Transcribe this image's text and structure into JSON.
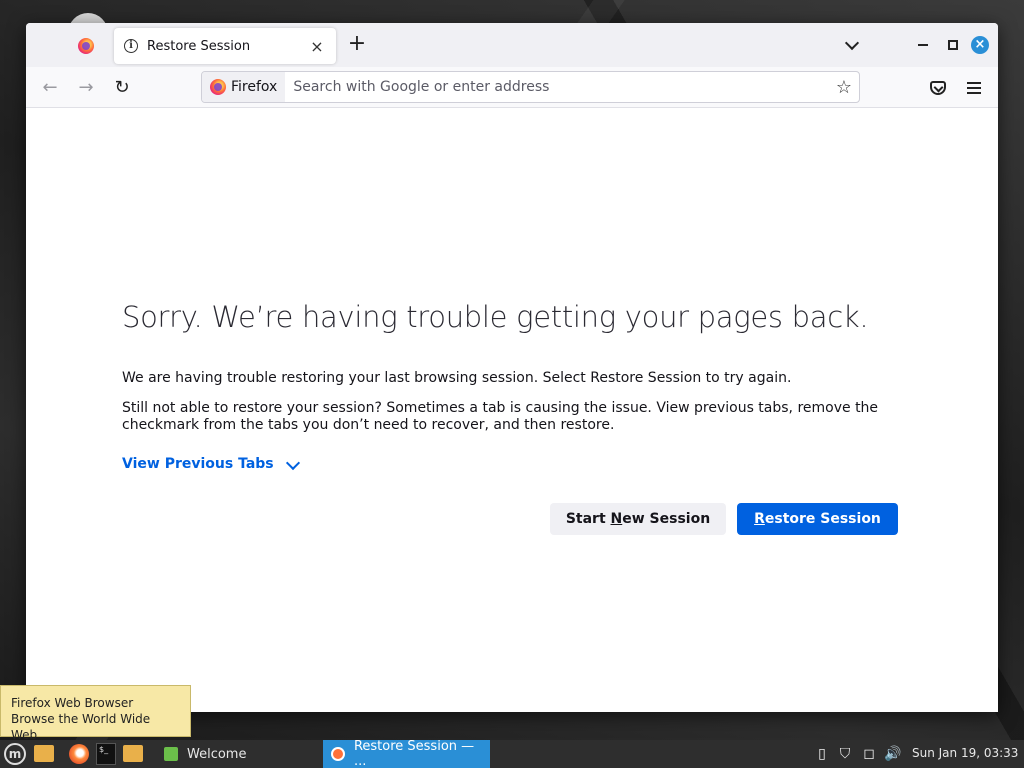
{
  "window": {
    "tab_title": "Restore Session",
    "tab_close": "×",
    "new_tab": "+"
  },
  "navbar": {
    "back": "←",
    "forward": "→",
    "reload": "↻",
    "identity_label": "Firefox",
    "url_placeholder": "Search with Google or enter address",
    "star": "☆"
  },
  "page": {
    "headline": "Sorry. We’re having trouble getting your pages back.",
    "paragraph1": "We are having trouble restoring your last browsing session. Select Restore Session to try again.",
    "paragraph2": "Still not able to restore your session? Sometimes a tab is causing the issue. View previous tabs, remove the checkmark from the tabs you don’t need to recover, and then restore.",
    "view_previous_tabs": "View Previous Tabs",
    "start_new_session": {
      "pre": "Start ",
      "accel": "N",
      "post": "ew Session"
    },
    "restore_session": {
      "accel": "R",
      "post": "estore Session"
    }
  },
  "tooltip": {
    "line1": "Firefox Web Browser",
    "line2": "Browse the World Wide Web"
  },
  "taskbar": {
    "welcome": "Welcome",
    "restore": "Restore Session — ...",
    "clock": "Sun Jan 19, 03:33"
  },
  "colors": {
    "accent": "#0061e0",
    "taskbar_active": "#2a8fd6",
    "tooltip_bg": "#f7e8a6"
  }
}
